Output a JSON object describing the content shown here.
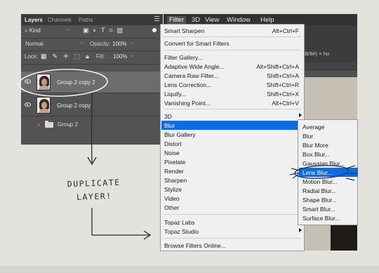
{
  "layers_panel": {
    "tabs": [
      "Layers",
      "Channels",
      "Paths"
    ],
    "filter_kind": "Kind",
    "blend_mode": "Normal",
    "opacity_label": "Opacity:",
    "opacity_value": "100%",
    "lock_label": "Lock:",
    "fill_label": "Fill:",
    "fill_value": "100%",
    "layers": [
      {
        "name": "Group 2 copy 2",
        "selected": true
      },
      {
        "name": "Group 2 copy",
        "selected": false
      }
    ],
    "group_name": "Group 2"
  },
  "annotation": {
    "line1": "DUPLICATE",
    "line2": "LAYER!"
  },
  "menubar": {
    "items": [
      "Filter",
      "3D",
      "View",
      "Window",
      "Help"
    ]
  },
  "doc_tab": "RGB/8#) ×   ho",
  "filter_menu": {
    "items": [
      {
        "label": "Smart Sharpen",
        "shortcut": "Alt+Ctrl+F"
      },
      {
        "label": "Convert for Smart Filters",
        "shortcut": ""
      },
      {
        "label": "Filter Gallery...",
        "shortcut": ""
      },
      {
        "label": "Adaptive Wide Angle...",
        "shortcut": "Alt+Shift+Ctrl+A"
      },
      {
        "label": "Camera Raw Filter...",
        "shortcut": "Shift+Ctrl+A"
      },
      {
        "label": "Lens Correction...",
        "shortcut": "Shift+Ctrl+R"
      },
      {
        "label": "Liquify...",
        "shortcut": "Shift+Ctrl+X"
      },
      {
        "label": "Vanishing Point...",
        "shortcut": "Alt+Ctrl+V"
      },
      {
        "label": "3D",
        "shortcut": ""
      },
      {
        "label": "Blur",
        "shortcut": ""
      },
      {
        "label": "Blur Gallery",
        "shortcut": ""
      },
      {
        "label": "Distort",
        "shortcut": ""
      },
      {
        "label": "Noise",
        "shortcut": ""
      },
      {
        "label": "Pixelate",
        "shortcut": ""
      },
      {
        "label": "Render",
        "shortcut": ""
      },
      {
        "label": "Sharpen",
        "shortcut": ""
      },
      {
        "label": "Stylize",
        "shortcut": ""
      },
      {
        "label": "Video",
        "shortcut": ""
      },
      {
        "label": "Other",
        "shortcut": ""
      },
      {
        "label": "Topaz Labs",
        "shortcut": ""
      },
      {
        "label": "Topaz Studio",
        "shortcut": ""
      },
      {
        "label": "Browse Filters Online...",
        "shortcut": ""
      }
    ]
  },
  "blur_menu": {
    "items": [
      "Average",
      "Blur",
      "Blur More",
      "Box Blur...",
      "Gaussian Blur...",
      "Lens Blur...",
      "Motion Blur...",
      "Radial Blur...",
      "Shape Blur...",
      "Smart Blur...",
      "Surface Blur..."
    ]
  },
  "colors": {
    "highlight": "#0d6ce0",
    "annotation_ink": "#2c2c2c",
    "background": "#e4e2dc"
  }
}
